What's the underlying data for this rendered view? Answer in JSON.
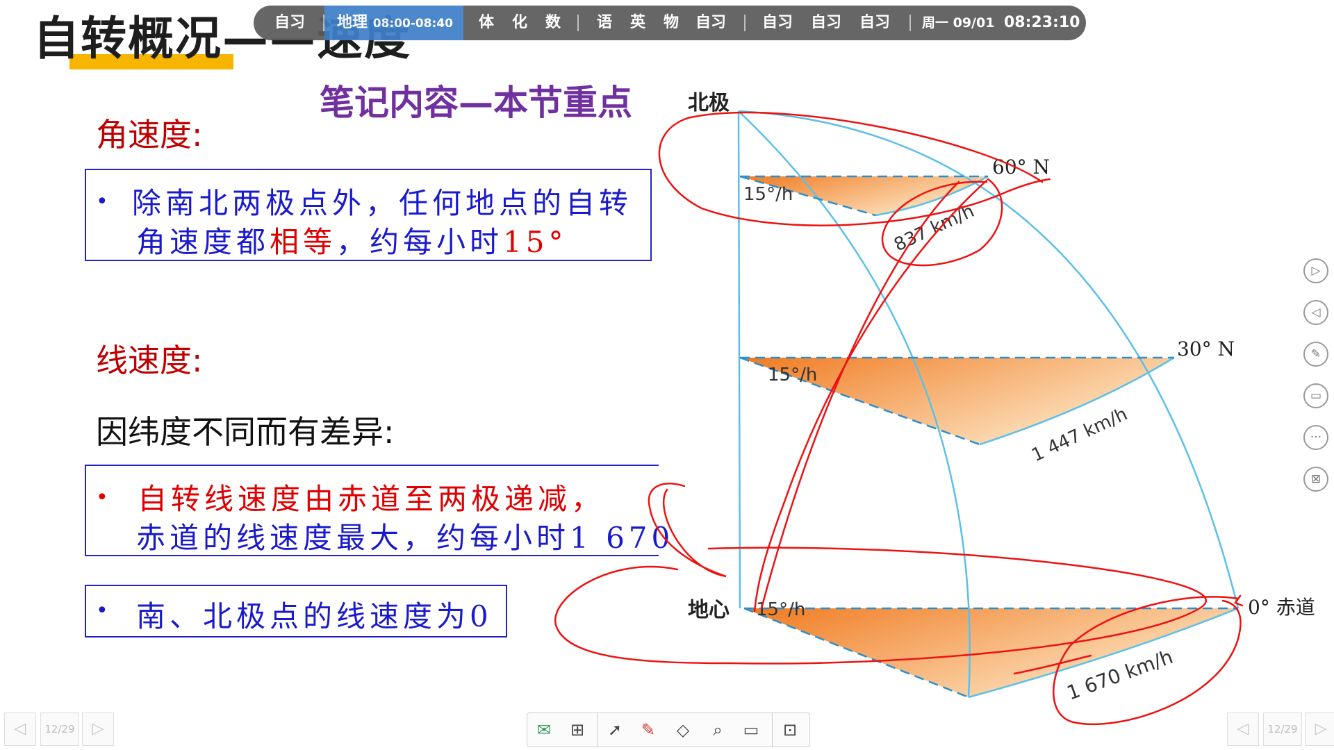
{
  "slide": {
    "title": "自转概况——速度",
    "subtitle": "笔记内容—本节重点"
  },
  "schedule_bar": {
    "items": [
      "自习",
      "地理",
      "08:00-08:40",
      "体",
      "化",
      "数",
      "语",
      "英",
      "物",
      "自习",
      "自习",
      "自习",
      "自习"
    ],
    "date": "周一 09/01",
    "clock": "08:23:10"
  },
  "angular": {
    "heading": "角速度:",
    "line1": "除南北两极点外，任何地点的自转",
    "line2_prefix": "角速度都",
    "line2_highlight": "相等",
    "line2_mid": "，约每小时",
    "line2_value": "15°"
  },
  "linear": {
    "heading": "线速度:",
    "intro": "因纬度不同而有差异:",
    "box1_line1": "自转线速度由赤道至两极递减，",
    "box1_line2": "赤道的线速度最大，约每小时1 670",
    "box2": "南、北极点的线速度为0"
  },
  "diagram": {
    "north_pole": "北极",
    "earth_center": "地心",
    "lat60": "60° N",
    "lat30": "30° N",
    "lat0": "0° 赤道",
    "angle_top": "15°/h",
    "angle_mid": "15°/h",
    "angle_bottom": "15°/h",
    "speed60": "837 km/h",
    "speed30": "1 447 km/h",
    "speed0": "1 670 km/h",
    "colors": {
      "frame": "#5bc0e8",
      "ink": "#ee1111",
      "fill_dark": "#f07a20",
      "fill_light": "#fde8c8"
    }
  },
  "nav": {
    "page": "12/29"
  },
  "side_tools": [
    "play-icon",
    "back-icon",
    "pen-icon",
    "screen-icon",
    "more-icon",
    "exit-icon"
  ],
  "toolbar_tools": [
    "whiteboard-icon",
    "grid-icon",
    "pointer-icon",
    "pen-icon",
    "eraser-icon",
    "magnifier-icon",
    "projector-icon",
    "exit-slide-icon"
  ]
}
